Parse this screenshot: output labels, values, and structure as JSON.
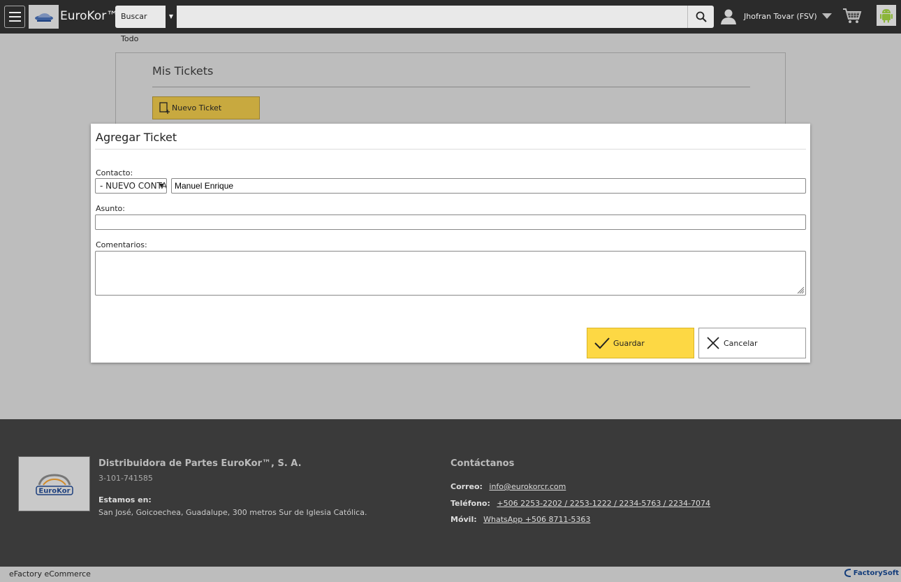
{
  "header": {
    "brand": "EuroKor™",
    "search_category": "Buscar Todo",
    "search_placeholder": "",
    "user_name": "Jhofran Tovar (FSV)"
  },
  "page": {
    "title": "Mis Tickets",
    "new_ticket_label": "Nuevo Ticket"
  },
  "modal": {
    "title": "Agregar Ticket",
    "contact_label": "Contacto:",
    "contact_select_value": "- NUEVO CONTACTO -",
    "contact_name_value": "Manuel Enrique",
    "subject_label": "Asunto:",
    "subject_value": "",
    "comments_label": "Comentarios:",
    "comments_value": "",
    "save_label": "Guardar",
    "cancel_label": "Cancelar"
  },
  "footer": {
    "company": "Distribuidora de Partes EuroKor™, S. A.",
    "company_id": "3-101-741585",
    "location_label": "Estamos en:",
    "location": "San José, Goicoechea, Guadalupe, 300 metros Sur de Iglesia Católica.",
    "contact_title": "Contáctanos",
    "email_label": "Correo:",
    "email": "info@eurokorcr.com",
    "phone_label": "Teléfono:",
    "phones": "+506 2253-2202 / 2253-1222 / 2234-5763 / 2234-7074",
    "mobile_label": "Móvil:",
    "mobile": "WhatsApp +506 8711-5363",
    "logo_text": "EuroKor"
  },
  "bottom": {
    "left_text": "eFactory eCommerce",
    "powered_text": "FactorySoft"
  },
  "colors": {
    "topbar": "#2b2b2b",
    "save_button": "#fdd844",
    "new_ticket_button": "#c8a93f",
    "footer": "#3a3a3a"
  }
}
